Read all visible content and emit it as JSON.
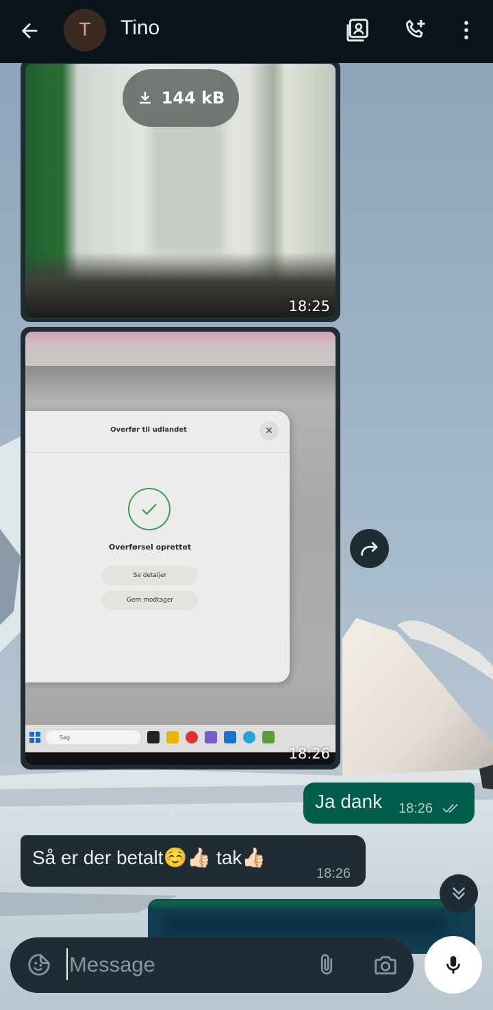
{
  "header": {
    "avatar_initial": "T",
    "contact_name": "Tino",
    "icons": [
      "back-arrow-icon",
      "contact-card-icon",
      "add-call-icon",
      "more-vert-icon"
    ]
  },
  "messages": {
    "image1": {
      "download_size": "144 kB",
      "time": "18:25"
    },
    "image2": {
      "time": "18:26",
      "photo": {
        "dialog_title": "Overfør til udlandet",
        "close_glyph": "✕",
        "success_text": "Overførsel oprettet",
        "button1": "Se detaljer",
        "button2": "Gem modtager",
        "taskbar_search": "Søg"
      }
    },
    "outgoing": {
      "text": "Ja dank",
      "time": "18:26"
    },
    "incoming": {
      "text": "Så er der betalt☺️👍🏻 tak👍🏻",
      "time": "18:26"
    }
  },
  "composer": {
    "placeholder": "Message"
  },
  "colors": {
    "header_bg": "#0b141a",
    "bubble_in": "#1f2c33",
    "bubble_out": "#005c4b",
    "read_ticks": "#b5cec8",
    "mic_button": "#ffffff"
  }
}
